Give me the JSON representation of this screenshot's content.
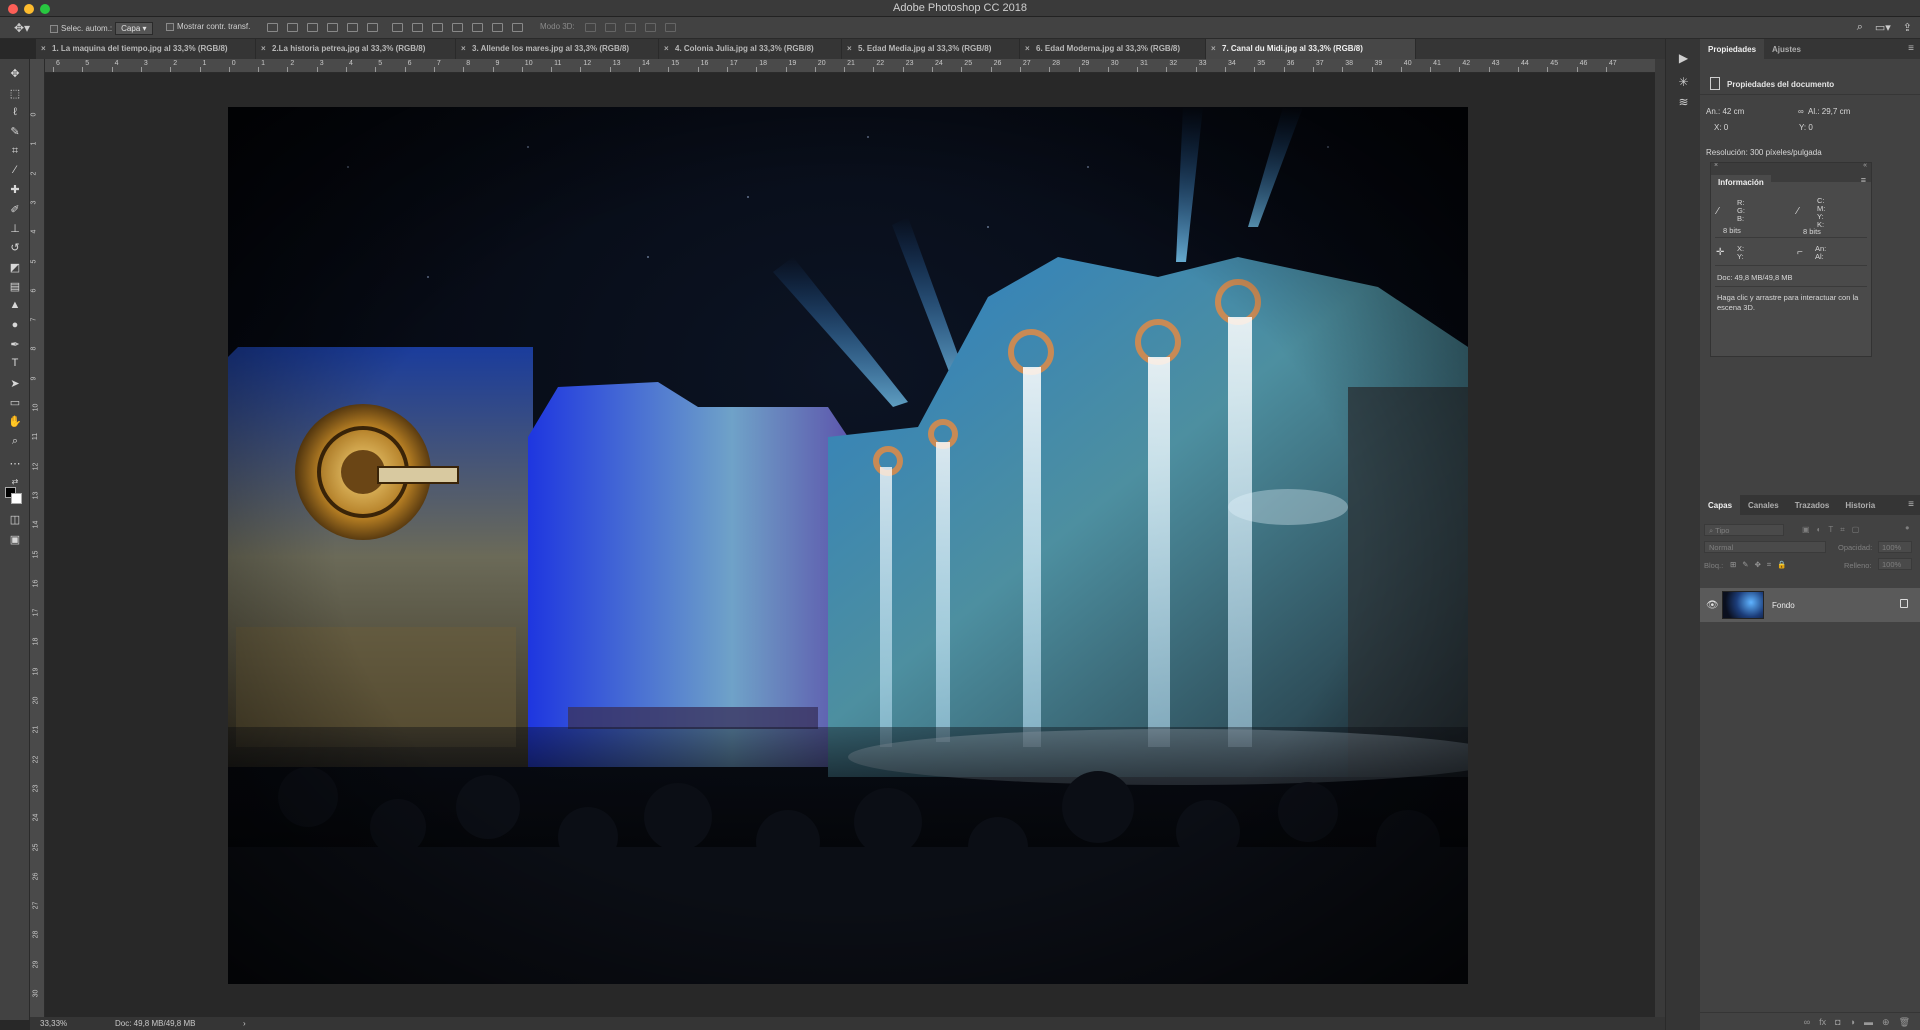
{
  "app": {
    "title": "Adobe Photoshop CC 2018"
  },
  "options": {
    "auto_select_label": "Selec. autom.:",
    "auto_select_value": "Capa",
    "show_transform_label": "Mostrar contr. transf.",
    "mode_3d_label": "Modo 3D:"
  },
  "tabs": [
    {
      "label": "1. La maquina del tiempo.jpg al 33,3% (RGB/8)"
    },
    {
      "label": "2.La historia petrea.jpg al 33,3% (RGB/8)"
    },
    {
      "label": "3. Allende los mares.jpg al 33,3% (RGB/8)"
    },
    {
      "label": "4. Colonia Julia.jpg al 33,3% (RGB/8)"
    },
    {
      "label": "5. Edad Media.jpg al 33,3% (RGB/8)"
    },
    {
      "label": "6. Edad Moderna.jpg al 33,3% (RGB/8)"
    },
    {
      "label": "7. Canal du Midi.jpg al 33,3% (RGB/8)"
    }
  ],
  "ruler_top": [
    "6",
    "5",
    "4",
    "3",
    "2",
    "1",
    "0",
    "1",
    "2",
    "3",
    "4",
    "5",
    "6",
    "7",
    "8",
    "9",
    "10",
    "11",
    "12",
    "13",
    "14",
    "15",
    "16",
    "17",
    "18",
    "19",
    "20",
    "21",
    "22",
    "23",
    "24",
    "25",
    "26",
    "27",
    "28",
    "29",
    "30",
    "31",
    "32",
    "33",
    "34",
    "35",
    "36",
    "37",
    "38",
    "39",
    "40",
    "41",
    "42",
    "43",
    "44",
    "45",
    "46",
    "47"
  ],
  "ruler_left": [
    "0",
    "1",
    "2",
    "3",
    "4",
    "5",
    "6",
    "7",
    "8",
    "9",
    "10",
    "11",
    "12",
    "13",
    "14",
    "15",
    "16",
    "17",
    "18",
    "19",
    "20",
    "21",
    "22",
    "23",
    "24",
    "25",
    "26",
    "27",
    "28",
    "29",
    "30"
  ],
  "status": {
    "zoom": "33,33%",
    "doc": "Doc: 49,8 MB/49,8 MB"
  },
  "properties": {
    "tab_active": "Propiedades",
    "tab_other": "Ajustes",
    "header": "Propiedades del documento",
    "width": "An.: 42 cm",
    "height": "Al.: 29,7 cm",
    "x": "X: 0",
    "y": "Y: 0",
    "resolution": "Resolución: 300 píxeles/pulgada"
  },
  "info": {
    "tab": "Información",
    "rgb_r": "R:",
    "rgb_g": "G:",
    "rgb_b": "B:",
    "bits_left": "8 bits",
    "cmyk_c": "C:",
    "cmyk_m": "M:",
    "cmyk_y": "Y:",
    "cmyk_k": "K:",
    "bits_right": "8 bits",
    "pos_x": "X:",
    "pos_y": "Y:",
    "size_w": "An:",
    "size_h": "Al:",
    "doc": "Doc: 49,8 MB/49,8 MB",
    "hint": "Haga clic y arrastre para interactuar con la escena 3D."
  },
  "layers": {
    "tabs": [
      "Capas",
      "Canales",
      "Trazados",
      "Historia"
    ],
    "filter_placeholder": "Tipo",
    "blend_mode": "Normal",
    "opacity_label": "Opacidad:",
    "opacity_value": "100%",
    "lock_label": "Bloq.:",
    "fill_label": "Relleno:",
    "fill_value": "100%",
    "layer_name": "Fondo"
  }
}
